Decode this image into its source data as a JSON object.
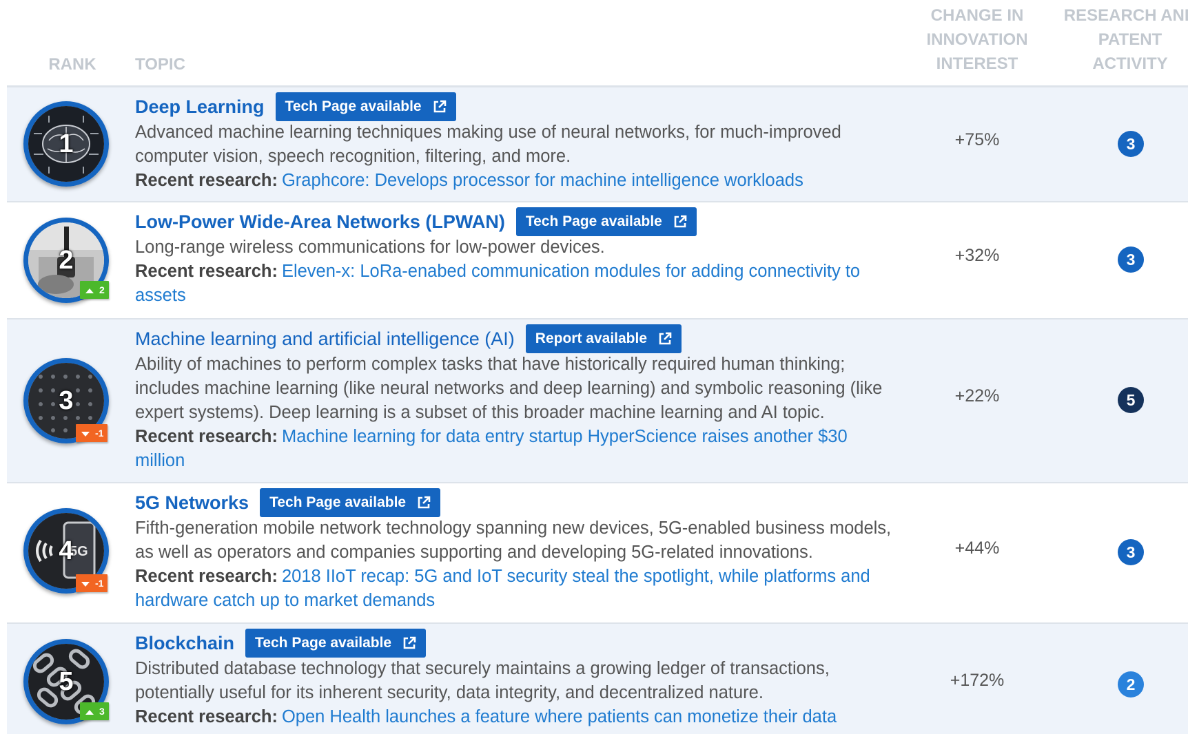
{
  "header": {
    "rank": "RANK",
    "topic": "TOPIC",
    "change": "CHANGE IN INNOVATION INTEREST",
    "research": "RESEARCH AND PATENT ACTIVITY"
  },
  "labels": {
    "recent_research": "Recent research:"
  },
  "rows": [
    {
      "rank": "1",
      "title": "Deep Learning",
      "pill": "Tech Page available",
      "description": "Advanced machine learning techniques making use of neural networks, for much-improved computer vision, speech recognition, filtering, and more.",
      "research_link": "Graphcore: Develops processor for machine intelligence workloads",
      "change": "+75%",
      "score": "3",
      "delta": ""
    },
    {
      "rank": "2",
      "title": "Low-Power Wide-Area Networks (LPWAN)",
      "pill": "Tech Page available",
      "description": "Long-range wireless communications for low-power devices.",
      "research_link": "Eleven-x: LoRa-enabed communication modules for adding connectivity to assets",
      "change": "+32%",
      "score": "3",
      "delta": "2"
    },
    {
      "rank": "3",
      "title": "Machine learning and artificial intelligence (AI)",
      "pill": "Report available",
      "description": "Ability of machines to perform complex tasks that have historically required human thinking; includes machine learning (like neural networks and deep learning) and symbolic reasoning (like expert systems). Deep learning is a subset of this broader machine learning and AI topic.",
      "research_link": "Machine learning for data entry startup HyperScience raises another $30 million",
      "change": "+22%",
      "score": "5",
      "delta": "-1"
    },
    {
      "rank": "4",
      "title": "5G Networks",
      "pill": "Tech Page available",
      "description": "Fifth-generation mobile network technology spanning new devices, 5G-enabled business models, as well as operators and companies supporting and developing 5G-related innovations.",
      "research_link": "2018 IIoT recap: 5G and IoT security steal the spotlight, while platforms and hardware catch up to market demands",
      "change": "+44%",
      "score": "3",
      "delta": "-1"
    },
    {
      "rank": "5",
      "title": "Blockchain",
      "pill": "Tech Page available",
      "description": "Distributed database technology that securely maintains a growing ledger of transactions, potentially useful for its inherent security, data integrity, and decentralized nature.",
      "research_link": "Open Health launches a feature where patients can monetize their data",
      "change": "+172%",
      "score": "2",
      "delta": "3"
    }
  ],
  "icons": {
    "badge_1": "brain-circuit-icon",
    "badge_2": "antenna-device-icon",
    "badge_3": "dot-grid-icon",
    "badge_4": "5g-phone-icon",
    "badge_5": "chain-icon",
    "external": "external-link-icon"
  },
  "colors": {
    "accent": "#1565c0",
    "link": "#1f7bd0",
    "up": "#4cb82b",
    "down": "#f26522",
    "score_dark": "#15325b",
    "score_mid": "#1565c0",
    "score_light": "#2a82dc"
  }
}
